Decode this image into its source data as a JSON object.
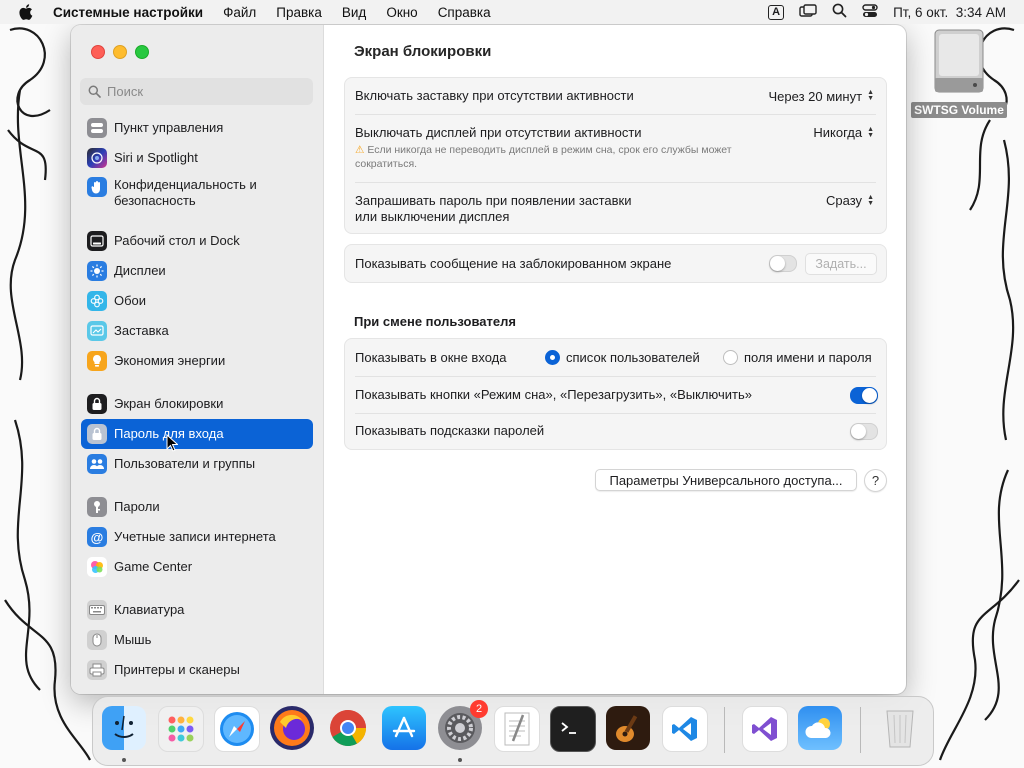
{
  "menubar": {
    "app_name": "Системные настройки",
    "items": [
      "Файл",
      "Правка",
      "Вид",
      "Окно",
      "Справка"
    ],
    "input_indicator": "A",
    "clock": "Пт, 6 окт.  3:34 AM"
  },
  "desktop": {
    "volume_label": "SWTSG Volume"
  },
  "sidebar": {
    "search_placeholder": "Поиск",
    "items": [
      {
        "label": "Пункт управления",
        "icon": "control-center-icon"
      },
      {
        "label": "Siri и Spotlight",
        "icon": "siri-icon"
      },
      {
        "label": "Конфиденциальность и безопасность",
        "icon": "hand-icon"
      },
      {
        "label": "Рабочий стол и Dock",
        "icon": "dock-icon"
      },
      {
        "label": "Дисплеи",
        "icon": "sun-icon"
      },
      {
        "label": "Обои",
        "icon": "flower-icon"
      },
      {
        "label": "Заставка",
        "icon": "screensaver-icon"
      },
      {
        "label": "Экономия энергии",
        "icon": "bulb-icon"
      },
      {
        "label": "Экран блокировки",
        "icon": "lock-screen-icon"
      },
      {
        "label": "Пароль для входа",
        "icon": "lock-icon"
      },
      {
        "label": "Пользователи и группы",
        "icon": "users-icon"
      },
      {
        "label": "Пароли",
        "icon": "key-icon"
      },
      {
        "label": "Учетные записи интернета",
        "icon": "at-icon"
      },
      {
        "label": "Game Center",
        "icon": "game-center-icon"
      },
      {
        "label": "Клавиатура",
        "icon": "keyboard-icon"
      },
      {
        "label": "Мышь",
        "icon": "mouse-icon"
      },
      {
        "label": "Принтеры и сканеры",
        "icon": "printer-icon"
      }
    ]
  },
  "main": {
    "title": "Экран блокировки",
    "screensaver_label": "Включать заставку при отсутствии активности",
    "screensaver_value": "Через 20 минут",
    "display_off_label": "Выключать дисплей при отсутствии активности",
    "display_off_value": "Никогда",
    "display_warning": "Если никогда не переводить дисплей в режим сна, срок его службы может сократиться.",
    "password_label_line1": "Запрашивать пароль при появлении заставки",
    "password_label_line2": "или выключении дисплея",
    "password_value": "Сразу",
    "message_label": "Показывать сообщение на заблокированном экране",
    "message_enabled": false,
    "set_button": "Задать...",
    "switch_section_title": "При смене пользователя",
    "login_window_label": "Показывать в окне входа",
    "login_option_list": "список пользователей",
    "login_option_fields": "поля имени и пароля",
    "login_option_selected": "список пользователей",
    "power_buttons_label": "Показывать кнопки «Режим сна», «Перезагрузить», «Выключить»",
    "power_buttons_enabled": true,
    "hints_label": "Показывать подсказки паролей",
    "hints_enabled": false,
    "accessibility_button": "Параметры Универсального доступа...",
    "help_button": "?"
  },
  "dock": {
    "apps": [
      "Finder",
      "Launchpad",
      "Safari",
      "Firefox",
      "Chrome",
      "App Store",
      "System Settings",
      "TextEdit",
      "Terminal",
      "GarageBand",
      "Visual Studio Code",
      "Visual Studio",
      "Weather",
      "Trash"
    ],
    "settings_badge": "2"
  }
}
